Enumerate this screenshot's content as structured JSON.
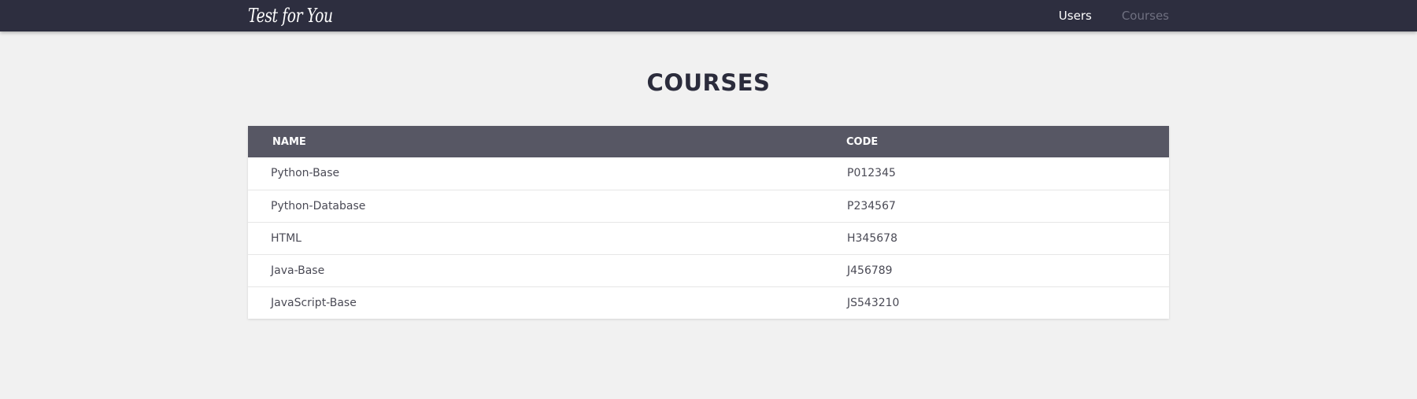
{
  "navbar": {
    "brand": "Test for You",
    "links": [
      {
        "label": "Users",
        "active": true
      },
      {
        "label": "Courses",
        "active": false
      }
    ]
  },
  "page": {
    "title": "COURSES"
  },
  "table": {
    "columns": [
      "NAME",
      "CODE"
    ],
    "rows": [
      {
        "name": "Python-Base",
        "code": "P012345"
      },
      {
        "name": "Python-Database",
        "code": "P234567"
      },
      {
        "name": "HTML",
        "code": "H345678"
      },
      {
        "name": "Java-Base",
        "code": "J456789"
      },
      {
        "name": "JavaScript-Base",
        "code": "JS543210"
      }
    ]
  },
  "colors": {
    "navbar_bg": "#2d2e3f",
    "page_bg": "#f1f1f1",
    "table_header_bg": "#575764",
    "active_link": "#ffffff",
    "inactive_link": "#6f7080"
  }
}
